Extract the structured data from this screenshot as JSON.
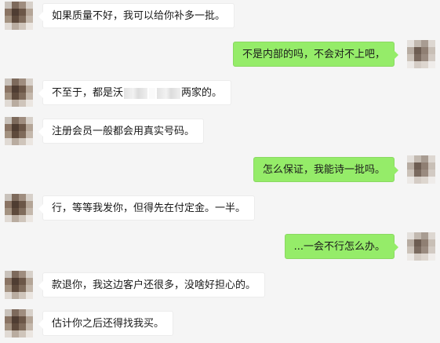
{
  "colors": {
    "background": "#f5f5f5",
    "incoming_bubble": "#ffffff",
    "outgoing_bubble": "#95ec69",
    "text": "#1a1a1a"
  },
  "messages": [
    {
      "side": "left",
      "text": "如果质量不好，我可以给你补多一批。"
    },
    {
      "side": "right",
      "text": "不是内部的吗，不会对不上吧，"
    },
    {
      "side": "left",
      "text_before": "不至于，都是沃",
      "text_after": "两家的。",
      "has_redaction": true
    },
    {
      "side": "left",
      "text": "注册会员一般都会用真实号码。"
    },
    {
      "side": "right",
      "text": "怎么保证，我能诗一批吗。"
    },
    {
      "side": "left",
      "text": "行，等等我发你，但得先在付定金。一半。"
    },
    {
      "side": "right",
      "text": "...一会不行怎么办。"
    },
    {
      "side": "left",
      "text": "款退你，我这边客户还很多，没啥好担心的。"
    },
    {
      "side": "left",
      "text": "估计你之后还得找我买。"
    }
  ]
}
